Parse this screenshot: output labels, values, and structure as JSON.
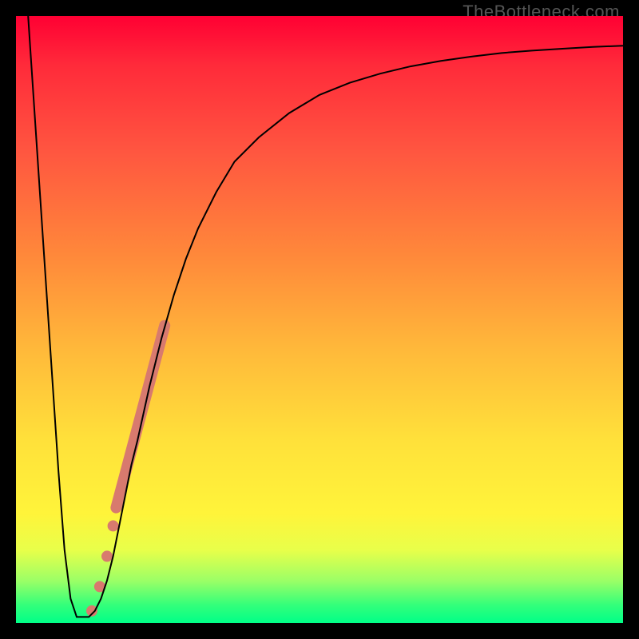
{
  "watermark": "TheBottleneck.com",
  "chart_data": {
    "type": "line",
    "title": "",
    "xlabel": "",
    "ylabel": "",
    "xlim": [
      0,
      100
    ],
    "ylim": [
      0,
      100
    ],
    "grid": false,
    "legend": false,
    "background_gradient": {
      "direction": "vertical",
      "stops": [
        {
          "pos": 0.0,
          "color": "#ff0033"
        },
        {
          "pos": 0.5,
          "color": "#ffb43a"
        },
        {
          "pos": 0.8,
          "color": "#fff43a"
        },
        {
          "pos": 1.0,
          "color": "#00ff88"
        }
      ]
    },
    "series": [
      {
        "name": "bottleneck-curve",
        "color": "#000000",
        "stroke_width": 2,
        "x": [
          2,
          3,
          4,
          5,
          6,
          7,
          8,
          9,
          10,
          11,
          12,
          13,
          14,
          15,
          16,
          17,
          18,
          19,
          20,
          22,
          24,
          26,
          28,
          30,
          33,
          36,
          40,
          45,
          50,
          55,
          60,
          65,
          70,
          75,
          80,
          85,
          90,
          95,
          100
        ],
        "y": [
          100,
          85,
          70,
          55,
          40,
          25,
          12,
          4,
          1,
          1,
          1,
          2,
          4,
          7,
          11,
          16,
          21,
          26,
          30,
          39,
          47,
          54,
          60,
          65,
          71,
          76,
          80,
          84,
          87,
          89,
          90.5,
          91.7,
          92.6,
          93.3,
          93.9,
          94.3,
          94.6,
          94.9,
          95.1
        ]
      },
      {
        "name": "highlight-band",
        "color": "#d87a6e",
        "stroke_width": 14,
        "x": [
          16.5,
          24.5
        ],
        "y": [
          19,
          49
        ]
      }
    ],
    "highlight_dots": {
      "color": "#d87a6e",
      "radius": 7,
      "points": [
        {
          "x": 12.5,
          "y": 2
        },
        {
          "x": 13.8,
          "y": 6
        },
        {
          "x": 15.0,
          "y": 11
        },
        {
          "x": 16.0,
          "y": 16
        }
      ]
    }
  }
}
